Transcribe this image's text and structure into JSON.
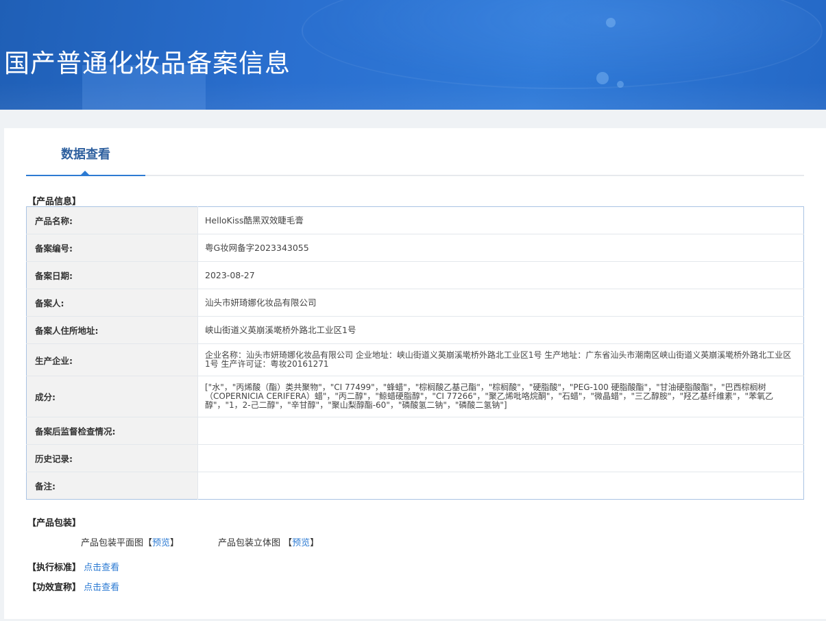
{
  "header": {
    "title": "国产普通化妆品备案信息"
  },
  "tabs": [
    {
      "label": "数据查看",
      "active": true
    }
  ],
  "product_info": {
    "section_label": "【产品信息】",
    "rows": [
      {
        "key": "产品名称:",
        "value": "HelloKiss酷黑双效睫毛膏"
      },
      {
        "key": "备案编号:",
        "value": "粤G妆网备字2023343055"
      },
      {
        "key": "备案日期:",
        "value": "2023-08-27"
      },
      {
        "key": "备案人:",
        "value": "汕头市妍琦娜化妆品有限公司"
      },
      {
        "key": "备案人住所地址:",
        "value": "峡山街道义英崩溪墘桥外路北工业区1号"
      },
      {
        "key": "生产企业:",
        "value": "企业名称：汕头市妍琦娜化妆品有限公司 企业地址：峡山街道义英崩溪墘桥外路北工业区1号 生产地址：广东省汕头市潮南区峡山街道义英崩溪墘桥外路北工业区1号 生产许可证：粤妆20161271"
      },
      {
        "key": "成分:",
        "value": "[\"水\"，\"丙烯酸（酯）类共聚物\"，\"CI 77499\"，\"蜂蜡\"，\"棕榈酸乙基己酯\"，\"棕榈酸\"，\"硬脂酸\"，\"PEG-100 硬脂酸酯\"，\"甘油硬脂酸酯\"，\"巴西棕榈树（COPERNICIA CERIFERA）蜡\"，\"丙二醇\"，\"鲸蜡硬脂醇\"，\"CI 77266\"，\"聚乙烯吡咯烷酮\"，\"石蜡\"，\"微晶蜡\"，\"三乙醇胺\"，\"羟乙基纤维素\"，\"苯氧乙醇\"，\"1，2-己二醇\"，\"辛甘醇\"，\"聚山梨醇酯-60\"，\"磷酸氢二钠\"，\"磷酸二氢钠\"]"
      },
      {
        "key": "备案后监督检查情况:",
        "value": ""
      },
      {
        "key": "历史记录:",
        "value": ""
      },
      {
        "key": "备注:",
        "value": ""
      }
    ]
  },
  "packaging": {
    "section_label": "【产品包装】",
    "flat_label": "产品包装平面图",
    "flat_link": "预览",
    "solid_label": "产品包装立体图",
    "solid_link": "预览",
    "bracket_open": "【",
    "bracket_close": "】"
  },
  "standard": {
    "label": "【执行标准】",
    "link": "点击查看"
  },
  "efficacy": {
    "label": "【功效宣称】",
    "link": "点击查看"
  }
}
